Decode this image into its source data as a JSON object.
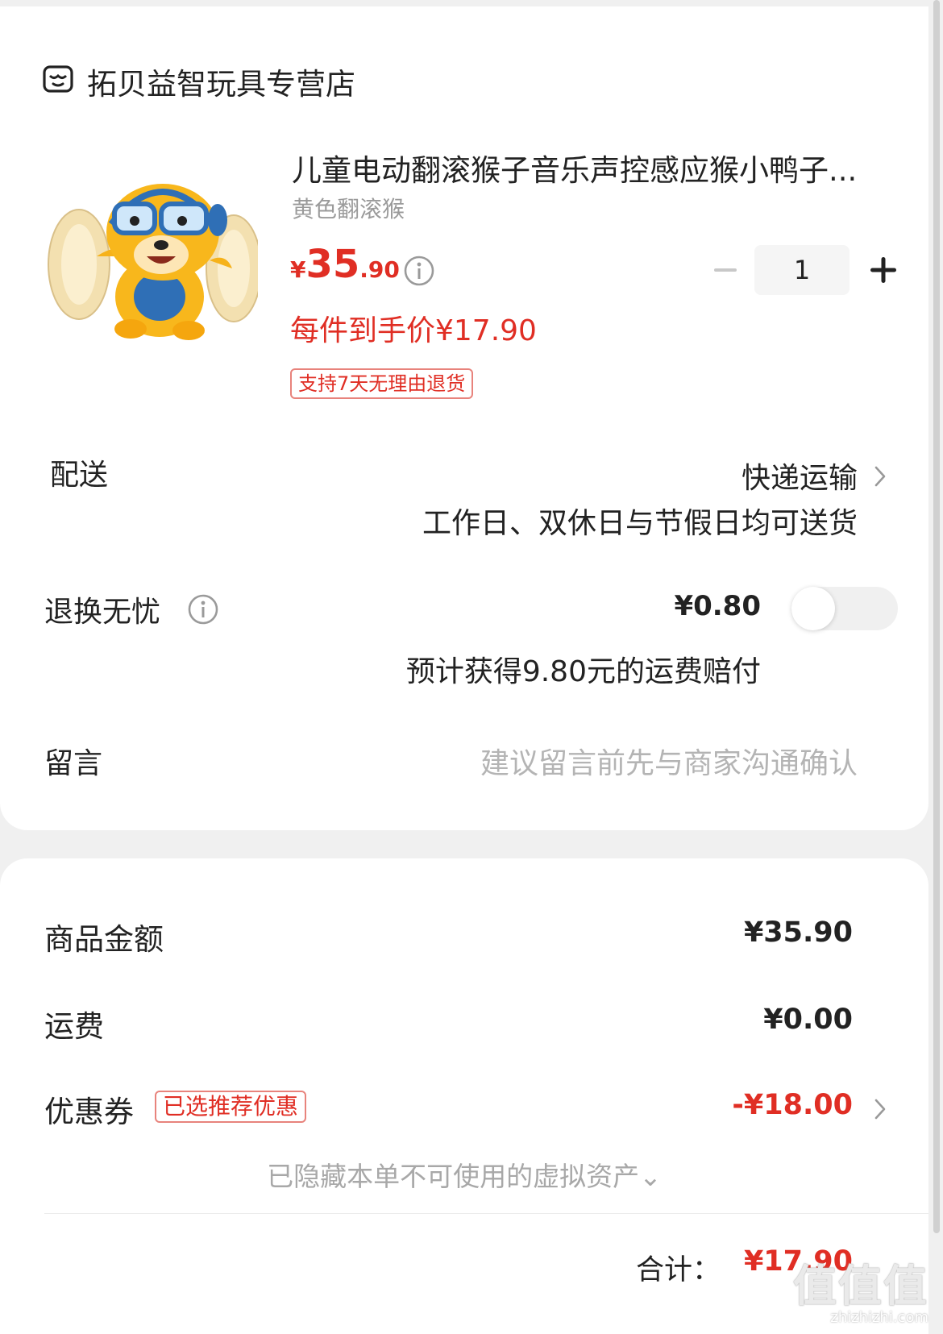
{
  "shop": {
    "icon": "store-icon",
    "name": "拓贝益智玩具专营店"
  },
  "product": {
    "image": "monkey-toy-image",
    "title": "儿童电动翻滚猴子音乐声控感应猴小鸭子...",
    "variant": "黄色翻滚猴",
    "price_symbol": "¥",
    "price_int": "35",
    "price_dec": ".90",
    "per_item_price": "每件到手价¥17.90",
    "return_tag": "支持7天无理由退货",
    "quantity": "1",
    "minus_icon": "minus-icon",
    "plus_icon": "plus-icon",
    "info_icon": "info-icon"
  },
  "delivery": {
    "label": "配送",
    "method": "快递运输",
    "note": "工作日、双休日与节假日均可送货",
    "chevron": "chevron-right-icon"
  },
  "return_insurance": {
    "label": "退换无忧",
    "price": "¥0.80",
    "note": "预计获得9.80元的运费赔付",
    "toggle_on": false
  },
  "message": {
    "label": "留言",
    "placeholder": "建议留言前先与商家沟通确认"
  },
  "summary": {
    "goods_label": "商品金额",
    "goods_value": "¥35.90",
    "shipping_label": "运费",
    "shipping_value": "¥0.00",
    "coupon_label": "优惠券",
    "coupon_tag": "已选推荐优惠",
    "coupon_value": "-¥18.00",
    "hidden_note": "已隐藏本单不可使用的虚拟资产⌄",
    "total_label": "合计：",
    "total_value": "¥17.90"
  },
  "watermark": {
    "big": "值值值",
    "small": "zhizhizhi.com"
  },
  "colors": {
    "accent_red": "#e02e24",
    "text": "#222222",
    "muted": "#b4b4b4",
    "bg": "#f0f0f0"
  }
}
